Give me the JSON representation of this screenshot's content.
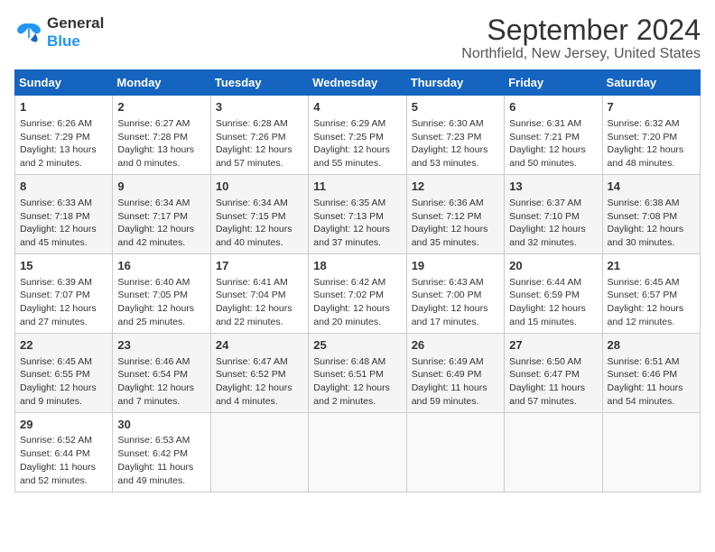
{
  "logo": {
    "line1": "General",
    "line2": "Blue"
  },
  "title": "September 2024",
  "subtitle": "Northfield, New Jersey, United States",
  "weekdays": [
    "Sunday",
    "Monday",
    "Tuesday",
    "Wednesday",
    "Thursday",
    "Friday",
    "Saturday"
  ],
  "weeks": [
    [
      {
        "num": "1",
        "sunrise": "6:26 AM",
        "sunset": "7:29 PM",
        "daylight": "13 hours and 2 minutes."
      },
      {
        "num": "2",
        "sunrise": "6:27 AM",
        "sunset": "7:28 PM",
        "daylight": "13 hours and 0 minutes."
      },
      {
        "num": "3",
        "sunrise": "6:28 AM",
        "sunset": "7:26 PM",
        "daylight": "12 hours and 57 minutes."
      },
      {
        "num": "4",
        "sunrise": "6:29 AM",
        "sunset": "7:25 PM",
        "daylight": "12 hours and 55 minutes."
      },
      {
        "num": "5",
        "sunrise": "6:30 AM",
        "sunset": "7:23 PM",
        "daylight": "12 hours and 53 minutes."
      },
      {
        "num": "6",
        "sunrise": "6:31 AM",
        "sunset": "7:21 PM",
        "daylight": "12 hours and 50 minutes."
      },
      {
        "num": "7",
        "sunrise": "6:32 AM",
        "sunset": "7:20 PM",
        "daylight": "12 hours and 48 minutes."
      }
    ],
    [
      {
        "num": "8",
        "sunrise": "6:33 AM",
        "sunset": "7:18 PM",
        "daylight": "12 hours and 45 minutes."
      },
      {
        "num": "9",
        "sunrise": "6:34 AM",
        "sunset": "7:17 PM",
        "daylight": "12 hours and 42 minutes."
      },
      {
        "num": "10",
        "sunrise": "6:34 AM",
        "sunset": "7:15 PM",
        "daylight": "12 hours and 40 minutes."
      },
      {
        "num": "11",
        "sunrise": "6:35 AM",
        "sunset": "7:13 PM",
        "daylight": "12 hours and 37 minutes."
      },
      {
        "num": "12",
        "sunrise": "6:36 AM",
        "sunset": "7:12 PM",
        "daylight": "12 hours and 35 minutes."
      },
      {
        "num": "13",
        "sunrise": "6:37 AM",
        "sunset": "7:10 PM",
        "daylight": "12 hours and 32 minutes."
      },
      {
        "num": "14",
        "sunrise": "6:38 AM",
        "sunset": "7:08 PM",
        "daylight": "12 hours and 30 minutes."
      }
    ],
    [
      {
        "num": "15",
        "sunrise": "6:39 AM",
        "sunset": "7:07 PM",
        "daylight": "12 hours and 27 minutes."
      },
      {
        "num": "16",
        "sunrise": "6:40 AM",
        "sunset": "7:05 PM",
        "daylight": "12 hours and 25 minutes."
      },
      {
        "num": "17",
        "sunrise": "6:41 AM",
        "sunset": "7:04 PM",
        "daylight": "12 hours and 22 minutes."
      },
      {
        "num": "18",
        "sunrise": "6:42 AM",
        "sunset": "7:02 PM",
        "daylight": "12 hours and 20 minutes."
      },
      {
        "num": "19",
        "sunrise": "6:43 AM",
        "sunset": "7:00 PM",
        "daylight": "12 hours and 17 minutes."
      },
      {
        "num": "20",
        "sunrise": "6:44 AM",
        "sunset": "6:59 PM",
        "daylight": "12 hours and 15 minutes."
      },
      {
        "num": "21",
        "sunrise": "6:45 AM",
        "sunset": "6:57 PM",
        "daylight": "12 hours and 12 minutes."
      }
    ],
    [
      {
        "num": "22",
        "sunrise": "6:45 AM",
        "sunset": "6:55 PM",
        "daylight": "12 hours and 9 minutes."
      },
      {
        "num": "23",
        "sunrise": "6:46 AM",
        "sunset": "6:54 PM",
        "daylight": "12 hours and 7 minutes."
      },
      {
        "num": "24",
        "sunrise": "6:47 AM",
        "sunset": "6:52 PM",
        "daylight": "12 hours and 4 minutes."
      },
      {
        "num": "25",
        "sunrise": "6:48 AM",
        "sunset": "6:51 PM",
        "daylight": "12 hours and 2 minutes."
      },
      {
        "num": "26",
        "sunrise": "6:49 AM",
        "sunset": "6:49 PM",
        "daylight": "11 hours and 59 minutes."
      },
      {
        "num": "27",
        "sunrise": "6:50 AM",
        "sunset": "6:47 PM",
        "daylight": "11 hours and 57 minutes."
      },
      {
        "num": "28",
        "sunrise": "6:51 AM",
        "sunset": "6:46 PM",
        "daylight": "11 hours and 54 minutes."
      }
    ],
    [
      {
        "num": "29",
        "sunrise": "6:52 AM",
        "sunset": "6:44 PM",
        "daylight": "11 hours and 52 minutes."
      },
      {
        "num": "30",
        "sunrise": "6:53 AM",
        "sunset": "6:42 PM",
        "daylight": "11 hours and 49 minutes."
      },
      null,
      null,
      null,
      null,
      null
    ]
  ]
}
